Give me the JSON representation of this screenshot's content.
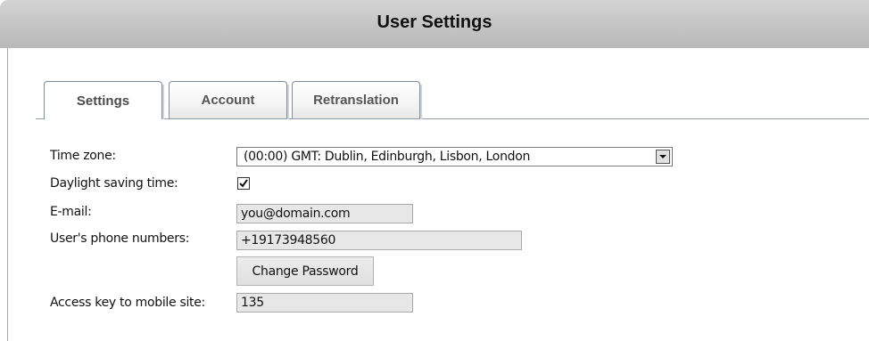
{
  "header": {
    "title": "User Settings"
  },
  "tabs": [
    {
      "label": "Settings",
      "active": true
    },
    {
      "label": "Account",
      "active": false
    },
    {
      "label": "Retranslation",
      "active": false
    }
  ],
  "form": {
    "time_zone": {
      "label": "Time zone:",
      "value": "(00:00) GMT: Dublin, Edinburgh, Lisbon, London"
    },
    "daylight_saving": {
      "label": "Daylight saving time:",
      "checked": true
    },
    "email": {
      "label": "E-mail:",
      "value": "you@domain.com"
    },
    "phone": {
      "label": "User's phone numbers:",
      "value": "+19173948560"
    },
    "change_password_label": "Change Password",
    "access_key": {
      "label": "Access key to mobile site:",
      "value": "135"
    }
  },
  "colors": {
    "title_bar": "#c4c4c4",
    "field_background": "#e7e7e7",
    "tab_border": "#7f8c99"
  }
}
